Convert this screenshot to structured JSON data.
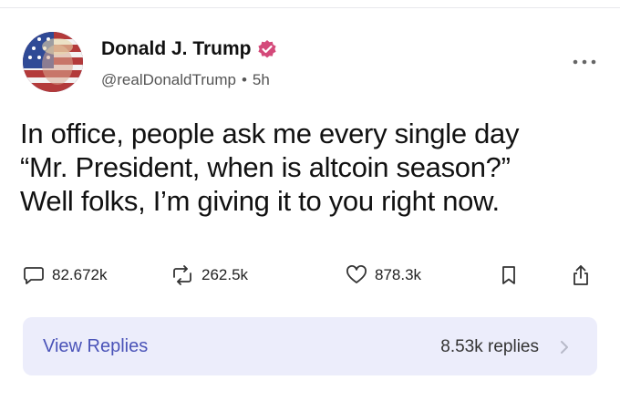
{
  "author": {
    "name": "Donald J. Trump",
    "handle": "@realDonaldTrump",
    "separator": "•",
    "time": "5h",
    "avatar_icon": "flag-portrait-avatar",
    "verified_icon": "verified-badge-icon"
  },
  "post": {
    "lines": [
      "In office, people ask me every single day",
      "“Mr. President, when is altcoin season?”",
      "Well folks, I’m giving it to you right now."
    ]
  },
  "actions": {
    "replies": "82.672k",
    "reposts": "262.5k",
    "likes": "878.3k"
  },
  "replies_bar": {
    "label": "View Replies",
    "count": "8.53k replies"
  },
  "colors": {
    "accent": "#4a53b8",
    "replies_bg": "#ecedfb",
    "verified": "#d44a7a"
  }
}
